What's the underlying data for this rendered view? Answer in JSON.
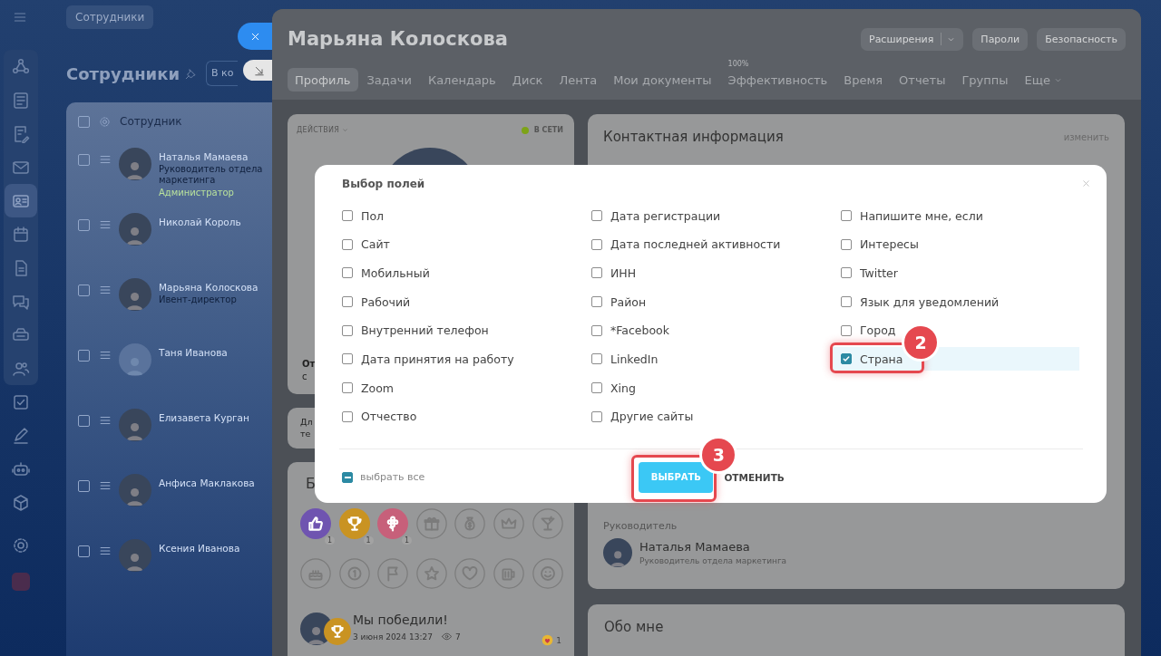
{
  "page": {
    "breadcrumb": "Сотрудники",
    "title": "Сотрудники",
    "view_button": "В ко",
    "menu": [
      {
        "selected": false
      },
      {
        "selected": false
      },
      {
        "selected": false
      },
      {
        "selected": false
      },
      {
        "selected": true
      },
      {
        "selected": false
      },
      {
        "selected": false
      },
      {
        "selected": false
      },
      {
        "selected": false
      },
      {
        "selected": false
      },
      {
        "selected": false
      },
      {
        "selected": false
      },
      {
        "selected": false
      },
      {
        "selected": false
      },
      {
        "selected": false
      }
    ],
    "table": {
      "column": "Сотрудник",
      "all_checked": false,
      "rows": [
        {
          "name": "Наталья Мамаева",
          "position": "Руководитель отдела маркетинга",
          "role": "Администратор",
          "kind": "photo",
          "checked": false
        },
        {
          "name": "Николай Король",
          "kind": "photo",
          "checked": false
        },
        {
          "name": "Марьяна Колоскова",
          "position": "Ивент-директор",
          "kind": "photo",
          "checked": false
        },
        {
          "name": "Таня Иванова",
          "kind": "placeholder",
          "checked": false
        },
        {
          "name": "Елизавета Курган",
          "kind": "photo",
          "checked": false
        },
        {
          "name": "Анфиса Маклакова",
          "kind": "photo",
          "checked": false
        },
        {
          "name": "Ксения Иванова",
          "kind": "photo",
          "checked": false
        }
      ]
    }
  },
  "profile": {
    "name": "Марьяна Колоскова",
    "buttons": [
      {
        "label": "Расширения",
        "kind": "split"
      },
      {
        "label": "Пароли",
        "kind": "plain"
      },
      {
        "label": "Безопасность",
        "kind": "plain"
      }
    ],
    "tabs": [
      {
        "label": "Профиль",
        "selected": true
      },
      {
        "label": "Задачи",
        "selected": false
      },
      {
        "label": "Календарь",
        "selected": false
      },
      {
        "label": "Диск",
        "selected": false
      },
      {
        "label": "Лента",
        "selected": false
      },
      {
        "label": "Мои документы",
        "selected": false
      },
      {
        "label": "Эффективность",
        "selected": false,
        "badge": "100%"
      },
      {
        "label": "Время",
        "selected": false
      },
      {
        "label": "Отчеты",
        "selected": false
      },
      {
        "label": "Группы",
        "selected": false
      },
      {
        "label": "Еще",
        "selected": false,
        "kind": "menu"
      }
    ],
    "profile_card": {
      "actions": "ДЕЙСТВИЯ",
      "status": "В СЕТИ",
      "online": true,
      "line_1": "От",
      "line_2": "с"
    },
    "note_card": {
      "line_1": "Дл",
      "line_2": "те"
    },
    "thanks_card": {
      "title": "Б",
      "badges": [
        {
          "kind": "filled",
          "color": "#6f54b0",
          "count": "1"
        },
        {
          "kind": "filled",
          "color": "#c99322",
          "count": "1"
        },
        {
          "kind": "filled",
          "color": "#c7607a",
          "count": "1"
        },
        {
          "kind": "outline"
        },
        {
          "kind": "outline"
        },
        {
          "kind": "outline"
        },
        {
          "kind": "outline"
        },
        {
          "kind": "outline"
        },
        {
          "kind": "outline"
        },
        {
          "kind": "outline"
        },
        {
          "kind": "outline"
        },
        {
          "kind": "outline"
        },
        {
          "kind": "outline"
        },
        {
          "kind": "outline"
        }
      ],
      "post": {
        "title": "Мы победили!",
        "date": "3 июня 2024 13:27",
        "views": "7",
        "reactions": "1"
      }
    },
    "contact_card": {
      "title": "Контактная информация",
      "edit_link": "изменить",
      "manager_label": "Руководитель",
      "manager": {
        "name": "Наталья Мамаева",
        "position": "Руководитель отдела маркетинга"
      }
    },
    "about_card": {
      "title": "Обо мне"
    }
  },
  "field_dialog": {
    "title": "Выбор полей",
    "columns": [
      [
        {
          "label": "Пол",
          "checked": false
        },
        {
          "label": "Сайт",
          "checked": false
        },
        {
          "label": "Мобильный",
          "checked": false
        },
        {
          "label": "Рабочий",
          "checked": false
        },
        {
          "label": "Внутренний телефон",
          "checked": false
        },
        {
          "label": "Дата принятия на работу",
          "checked": false
        },
        {
          "label": "Zoom",
          "checked": false
        },
        {
          "label": "Отчество",
          "checked": false
        }
      ],
      [
        {
          "label": "Дата регистрации",
          "checked": false
        },
        {
          "label": "Дата последней активности",
          "checked": false
        },
        {
          "label": "ИНН",
          "checked": false
        },
        {
          "label": "Район",
          "checked": false
        },
        {
          "label": "*Facebook",
          "checked": false
        },
        {
          "label": "LinkedIn",
          "checked": false
        },
        {
          "label": "Xing",
          "checked": false
        },
        {
          "label": "Другие сайты",
          "checked": false
        }
      ],
      [
        {
          "label": "Напишите мне, если",
          "checked": false
        },
        {
          "label": "Интересы",
          "checked": false
        },
        {
          "label": "Twitter",
          "checked": false
        },
        {
          "label": "Язык для уведомлений",
          "checked": false
        },
        {
          "label": "Город",
          "checked": false
        },
        {
          "label": "Страна",
          "checked": true,
          "callout": "2"
        }
      ]
    ],
    "select_all": {
      "label": "выбрать все",
      "indeterminate": true
    },
    "buttons": [
      {
        "label": "ВЫБРАТЬ",
        "kind": "primary",
        "callout": "3"
      },
      {
        "label": "ОТМЕНИТЬ",
        "kind": "link"
      }
    ]
  }
}
